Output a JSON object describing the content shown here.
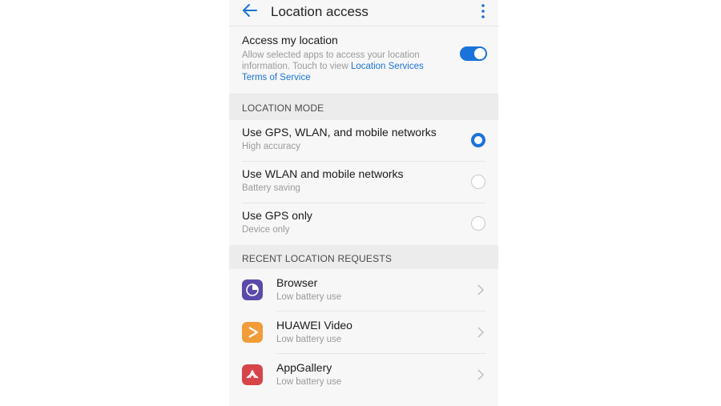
{
  "header": {
    "title": "Location access",
    "back_icon": "arrow-left-icon",
    "menu_icon": "more-vert-icon"
  },
  "access": {
    "title": "Access my location",
    "desc_text": "Allow selected apps to access your location information. Touch to view ",
    "link1": "Location Services",
    "link2": "Terms of Service",
    "enabled": true
  },
  "location_mode": {
    "header": "LOCATION MODE",
    "options": [
      {
        "title": "Use GPS, WLAN, and mobile networks",
        "subtitle": "High accuracy",
        "selected": true
      },
      {
        "title": "Use WLAN and mobile networks",
        "subtitle": "Battery saving",
        "selected": false
      },
      {
        "title": "Use GPS only",
        "subtitle": "Device only",
        "selected": false
      }
    ]
  },
  "recent": {
    "header": "RECENT LOCATION REQUESTS",
    "apps": [
      {
        "name": "Browser",
        "usage": "Low battery use",
        "icon": "browser-icon"
      },
      {
        "name": "HUAWEI Video",
        "usage": "Low battery use",
        "icon": "video-play-icon"
      },
      {
        "name": "AppGallery",
        "usage": "Low battery use",
        "icon": "appgallery-icon"
      }
    ]
  },
  "colors": {
    "accent": "#1a73d9",
    "browser": "#5b4aa8",
    "video": "#f29c38",
    "appgallery": "#d6454a"
  }
}
